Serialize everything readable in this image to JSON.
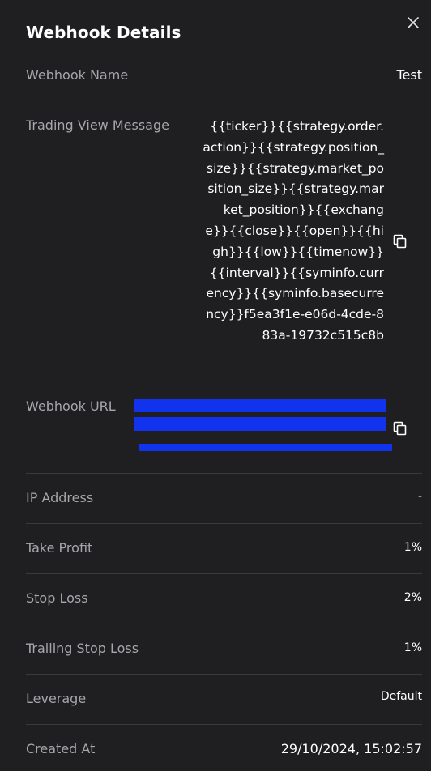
{
  "header": {
    "title": "Webhook Details"
  },
  "icons": {
    "close": "close-icon",
    "copy": "copy-icon"
  },
  "rows": {
    "webhook_name": {
      "label": "Webhook Name",
      "value": "Test"
    },
    "trading_view_message": {
      "label": "Trading View Message",
      "value": "{{ticker}}{{strategy.order.action}}{{strategy.position_size}}{{strategy.market_position_size}}{{strategy.market_position}}{{exchange}}{{close}}{{open}}{{high}}{{low}}{{timenow}}{{interval}}{{syminfo.currency}}{{syminfo.basecurrency}}f5ea3f1e-e06d-4cde-883a-19732c515c8b"
    },
    "webhook_url": {
      "label": "Webhook URL",
      "value": ""
    },
    "ip_address": {
      "label": "IP Address",
      "value": "-"
    },
    "take_profit": {
      "label": "Take Profit",
      "value": "1%"
    },
    "stop_loss": {
      "label": "Stop Loss",
      "value": "2%"
    },
    "trailing_stop_loss": {
      "label": "Trailing Stop Loss",
      "value": "1%"
    },
    "leverage": {
      "label": "Leverage",
      "value": "Default"
    },
    "created_at": {
      "label": "Created At",
      "value": "29/10/2024, 15:02:57"
    }
  },
  "colors": {
    "background": "#1f1f21",
    "divider": "#3a3a3d",
    "label": "#a6a6ab",
    "value": "#ffffff",
    "redaction": "#1133ee"
  }
}
